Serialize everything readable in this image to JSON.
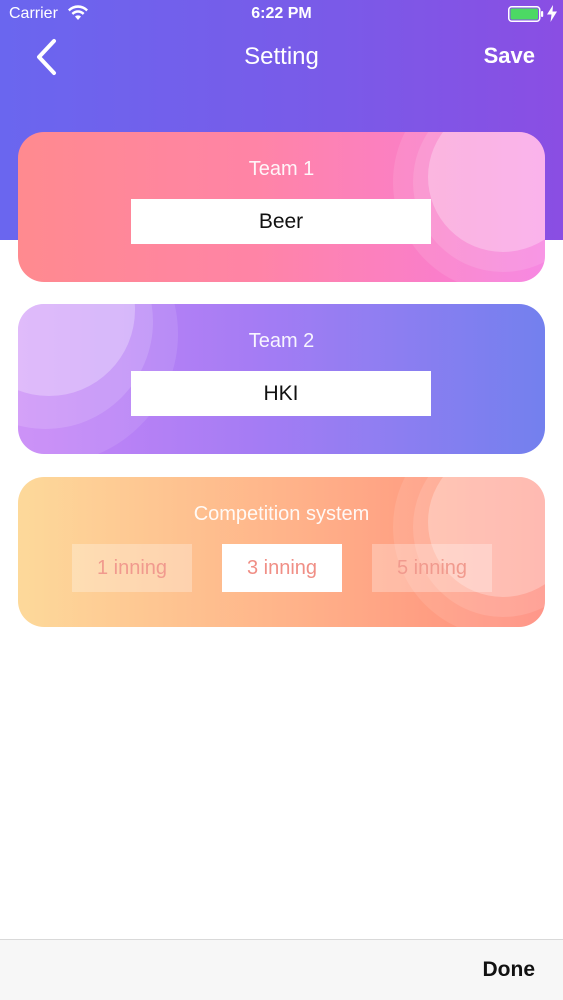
{
  "status_bar": {
    "carrier": "Carrier",
    "time": "6:22 PM"
  },
  "nav": {
    "title": "Setting",
    "save_label": "Save",
    "back_icon": "chevron-left-icon"
  },
  "team1": {
    "label": "Team 1",
    "value": "Beer"
  },
  "team2": {
    "label": "Team 2",
    "value": "HKI"
  },
  "competition": {
    "label": "Competition system",
    "options": [
      {
        "label": "1 inning",
        "selected": false
      },
      {
        "label": "3 inning",
        "selected": true
      },
      {
        "label": "5 inning",
        "selected": false
      }
    ]
  },
  "bottom_bar": {
    "done_label": "Done"
  },
  "colors": {
    "header": "#7a5ae8",
    "team1_card": "#ff84a6",
    "team2_card": "#a57cf4",
    "competition_card": "#ffb48a",
    "battery": "#4cd964"
  }
}
